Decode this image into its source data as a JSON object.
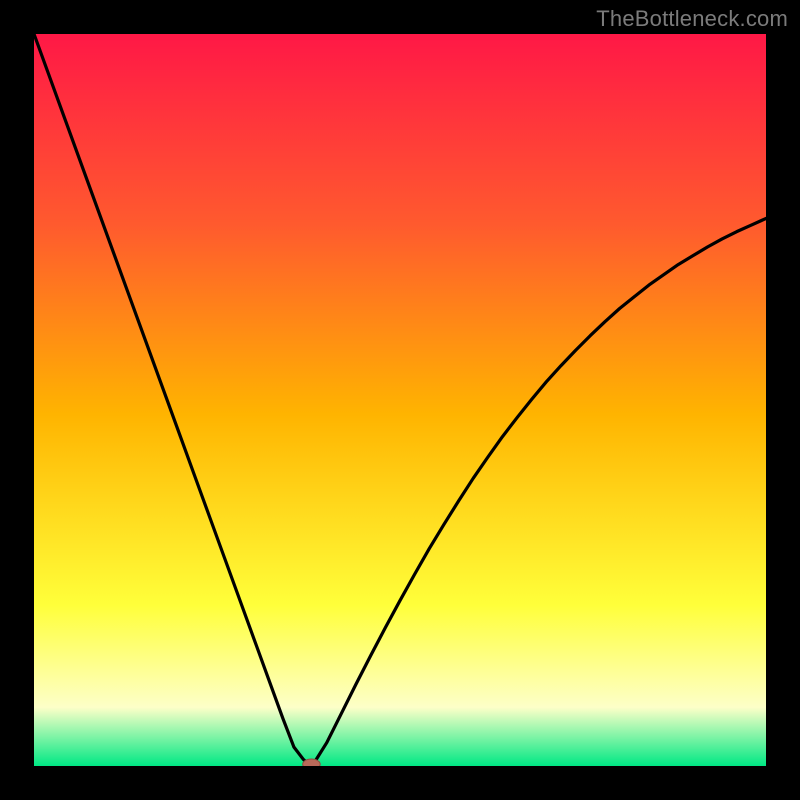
{
  "attribution": "TheBottleneck.com",
  "colors": {
    "frame": "#000000",
    "gradient_top": "#ff1846",
    "gradient_upper": "#ff5a2e",
    "gradient_mid": "#ffb400",
    "gradient_lower": "#ffff3a",
    "gradient_pale": "#fdffc8",
    "gradient_bottom": "#00e884",
    "curve": "#000000",
    "marker_fill": "#b96a5a",
    "marker_stroke": "#8d4f42"
  },
  "chart_data": {
    "type": "line",
    "title": "",
    "xlabel": "",
    "ylabel": "",
    "xlim": [
      0,
      100
    ],
    "ylim": [
      0,
      100
    ],
    "x": [
      0,
      2,
      4,
      6,
      8,
      10,
      12,
      14,
      16,
      18,
      20,
      22,
      24,
      26,
      28,
      30,
      32,
      34,
      35.5,
      36.8,
      37.6,
      37.8,
      38.5,
      40,
      42,
      44,
      46,
      48,
      50,
      52,
      54,
      56,
      58,
      60,
      62,
      64,
      66,
      68,
      70,
      72,
      74,
      76,
      78,
      80,
      82,
      84,
      86,
      88,
      90,
      92,
      94,
      96,
      98,
      100
    ],
    "values": [
      100,
      94.5,
      89,
      83.5,
      78,
      72.5,
      67,
      61.5,
      56,
      50.5,
      45,
      39.5,
      34,
      28.5,
      23,
      17.5,
      12,
      6.5,
      2.6,
      0.9,
      0.2,
      0.2,
      0.8,
      3.2,
      7.2,
      11.2,
      15.1,
      18.9,
      22.6,
      26.2,
      29.7,
      33.0,
      36.2,
      39.3,
      42.2,
      45.0,
      47.6,
      50.1,
      52.5,
      54.7,
      56.8,
      58.8,
      60.7,
      62.5,
      64.1,
      65.7,
      67.1,
      68.5,
      69.7,
      70.9,
      72.0,
      73.0,
      73.9,
      74.8
    ],
    "marker": {
      "x": 37.9,
      "y": 0.25,
      "rx": 1.2,
      "ry": 0.7
    }
  }
}
